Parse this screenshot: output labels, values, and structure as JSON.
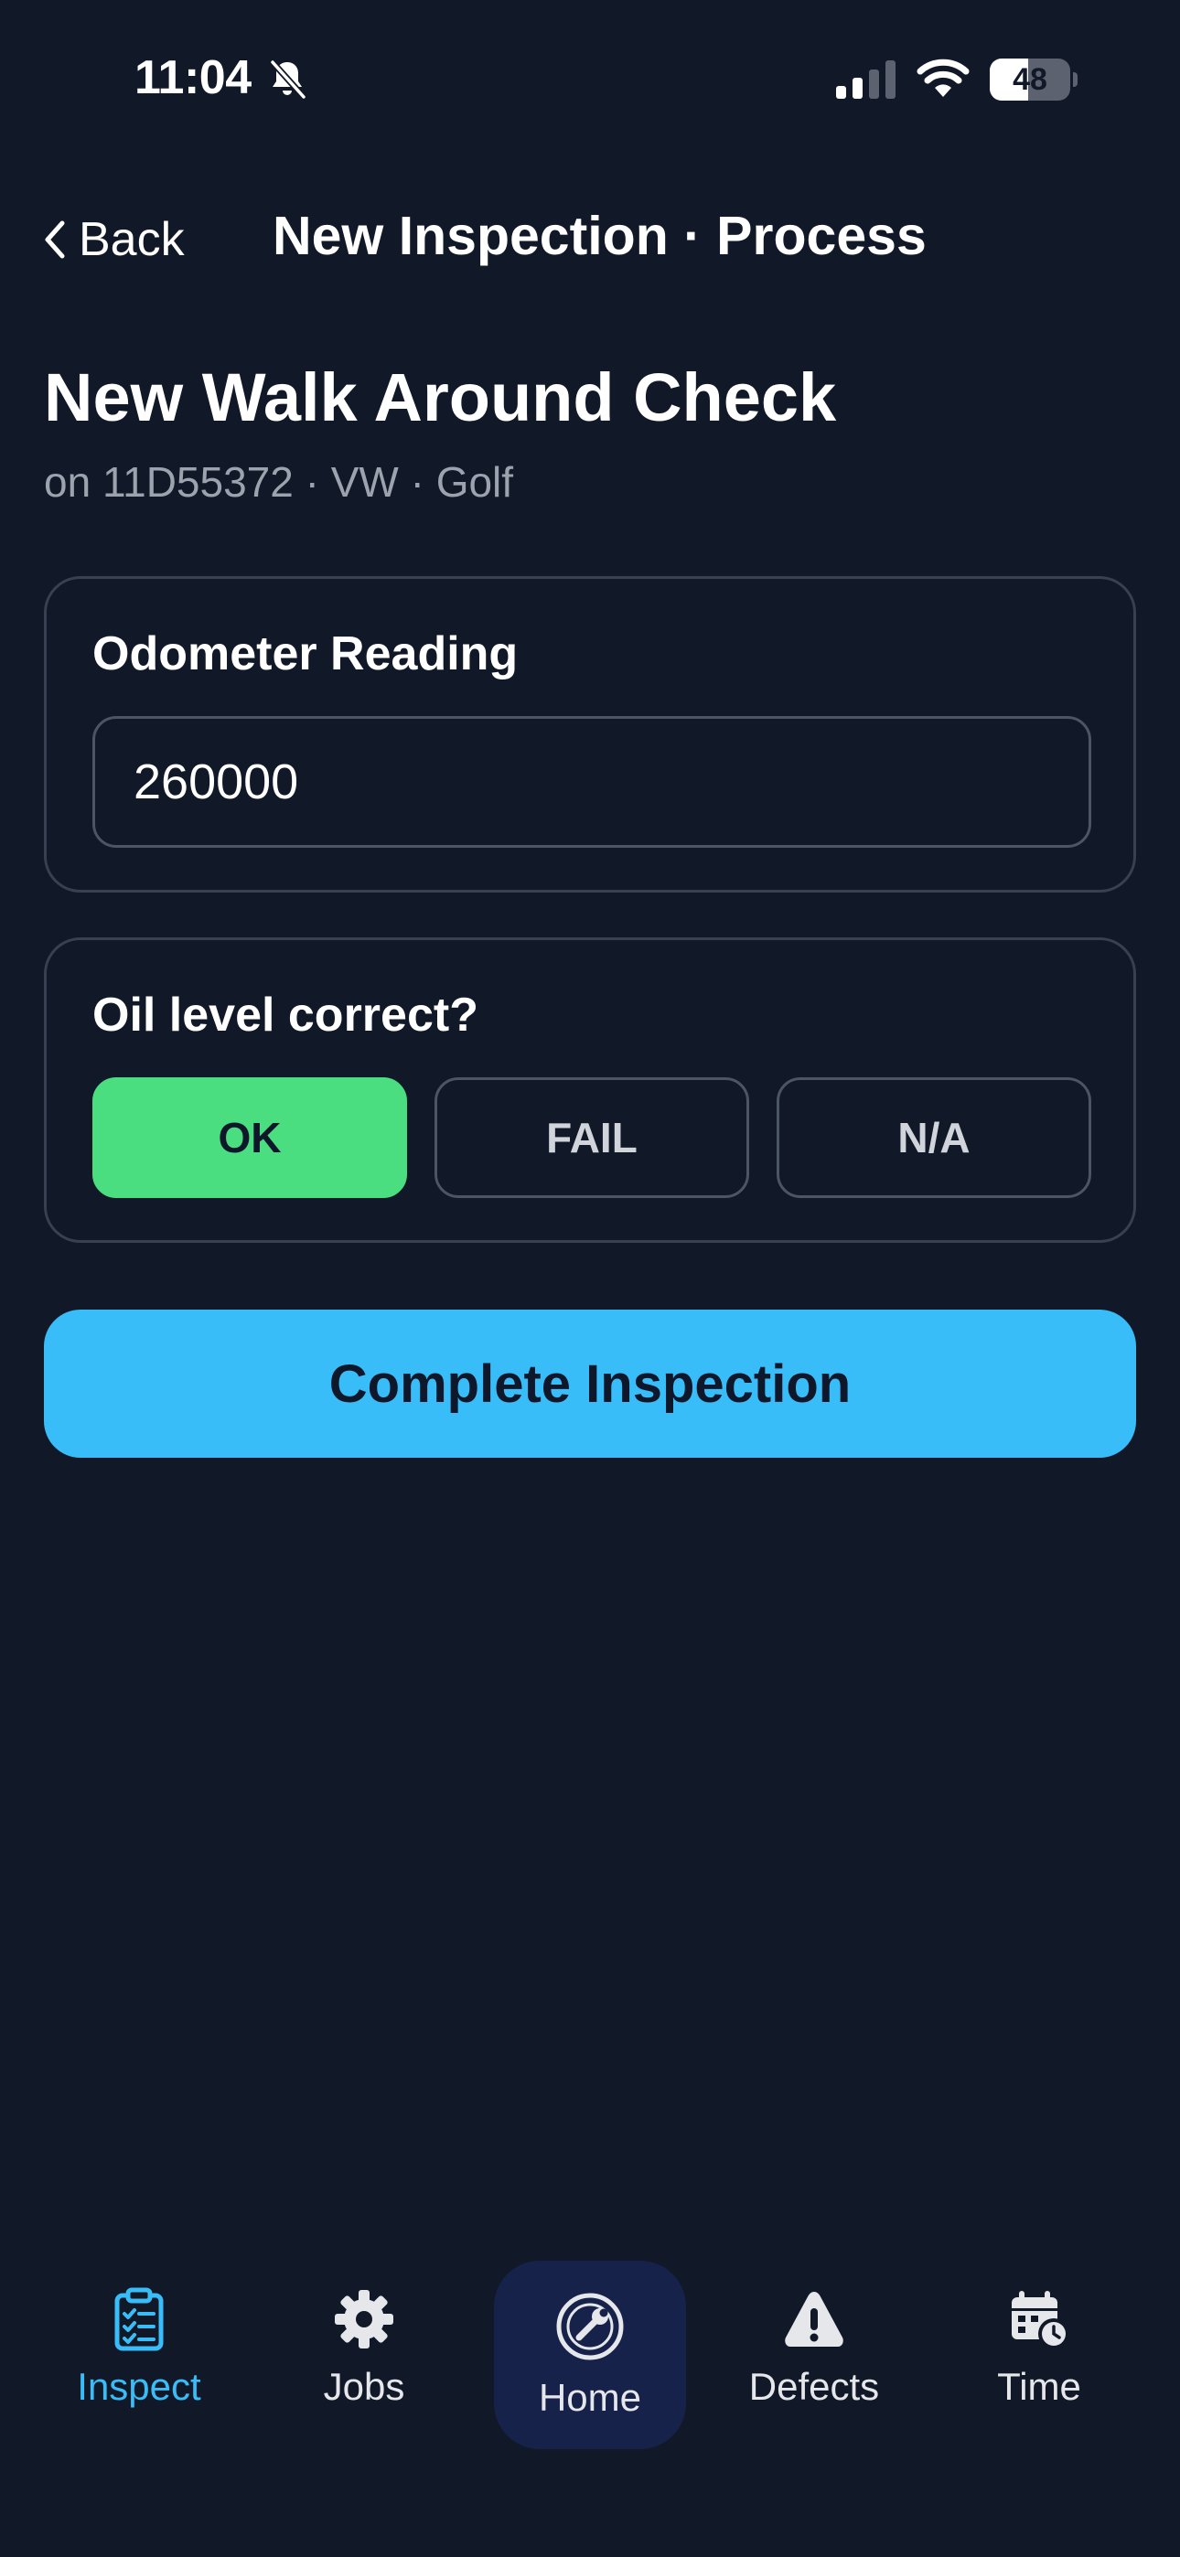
{
  "status_bar": {
    "time": "11:04",
    "battery_percent": "48",
    "battery_level": 0.48,
    "icons": [
      "bell-slash-icon",
      "cellular-signal-icon",
      "wifi-icon",
      "battery-icon"
    ]
  },
  "nav": {
    "back_label": "Back",
    "title": "New Inspection · Process"
  },
  "header": {
    "title": "New Walk Around Check",
    "subtitle": "on 11D55372 · VW · Golf"
  },
  "odometer": {
    "label": "Odometer Reading",
    "value": "260000"
  },
  "oil_check": {
    "question": "Oil level correct?",
    "options": [
      "OK",
      "FAIL",
      "N/A"
    ],
    "selected": "OK"
  },
  "complete_button": {
    "label": "Complete Inspection"
  },
  "tab_bar": {
    "tabs": [
      {
        "label": "Inspect",
        "icon": "clipboard-checklist-icon",
        "active": true
      },
      {
        "label": "Jobs",
        "icon": "gear-icon",
        "active": false
      },
      {
        "label": "Home",
        "icon": "wrench-circle-icon",
        "active": false
      },
      {
        "label": "Defects",
        "icon": "warning-triangle-icon",
        "active": false
      },
      {
        "label": "Time",
        "icon": "calendar-clock-icon",
        "active": false
      }
    ]
  },
  "colors": {
    "background": "#111827",
    "accent": "#38bdf8",
    "ok_selected": "#4ade80",
    "card_border": "#374151",
    "subtitle_text": "#9ca3af",
    "home_tab_bg": "#16224a"
  }
}
